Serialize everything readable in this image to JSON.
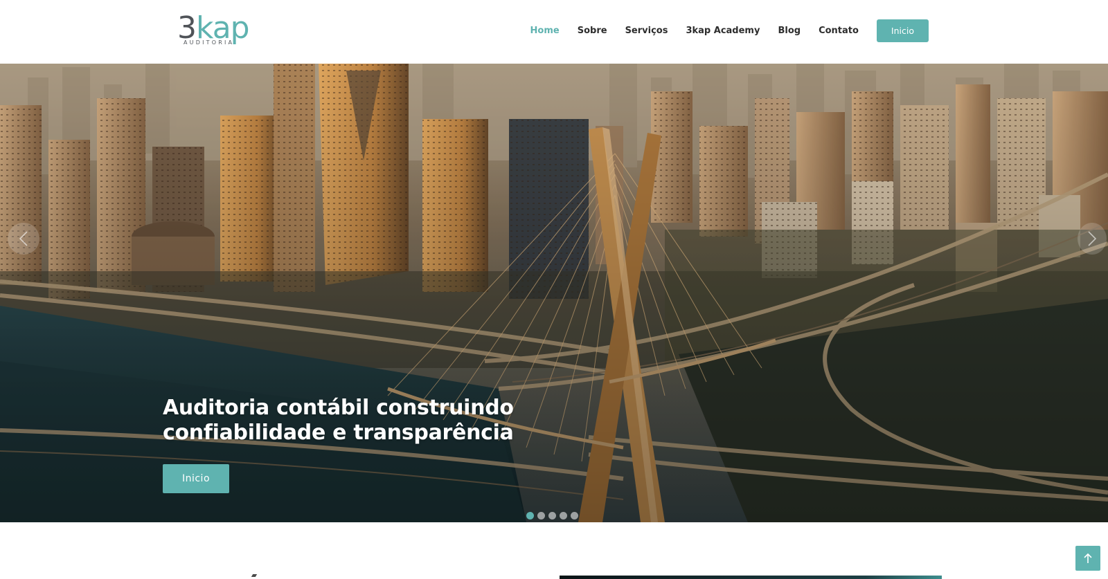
{
  "brand": {
    "logo_main_left": "3",
    "logo_main_right": "kap",
    "logo_sub": "AUDITORIA",
    "colors": {
      "accent": "#5fb3b0",
      "logo_gray": "#4f5358"
    }
  },
  "nav": {
    "items": [
      {
        "label": "Home",
        "active": true
      },
      {
        "label": "Sobre"
      },
      {
        "label": "Serviços"
      },
      {
        "label": "3kap Academy"
      },
      {
        "label": "Blog"
      },
      {
        "label": "Contato"
      }
    ],
    "cta_label": "Inicio"
  },
  "hero": {
    "title_line1": "Auditoria contábil construindo",
    "title_line2": "confiabilidade e transparência",
    "button_label": "Inicio",
    "slides_total": 5,
    "active_slide": 1,
    "prev_icon": "chevron-left-icon",
    "next_icon": "chevron-right-icon"
  },
  "scroll_top_icon": "arrow-up-icon"
}
